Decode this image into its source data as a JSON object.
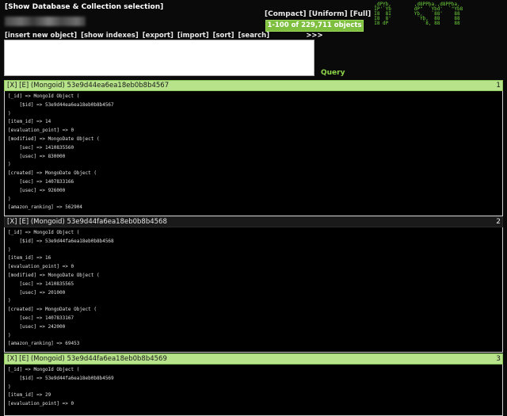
{
  "header": {
    "show_db_link": "[Show Database & Collection selection]",
    "view_compact": "[Compact]",
    "view_uniform": "[Uniform]",
    "view_full": "[Full]",
    "count_button": "1-100 of 229,711 objects >>>"
  },
  "ascii_logo": "  ,dPYb,        ,d8PPba.,d8PPba,\n  IP'`Yb        dP\"  `Ybd'  `\"Yb8\n  I8  8I        Yb,   `88'    88\n  I8  8'         `Yb,  88     88\n  I8 dP            `8, 88     88\n",
  "toolbar": {
    "insert": "[insert new object]",
    "indexes": "[show indexes]",
    "export": "[export]",
    "import": "[import]",
    "sort": "[sort]",
    "search": "[search]"
  },
  "query": {
    "value": "",
    "button": "Query"
  },
  "records": [
    {
      "title": "[X] [E] (Mongoid) 53e9d44ea6ea18eb0b8b4567",
      "num": "1",
      "lines": [
        "[_id] => MongoId Object (",
        "    [$id] => 53e9d44ea6ea18eb0b8b4567",
        ")",
        "[item_id] => 14",
        "[evaluation_point] => 0",
        "[modified] => MongoDate Object (",
        "    [sec] => 1410835560",
        "    [usec] => 830000",
        ")",
        "[created] => MongoDate Object (",
        "    [sec] => 1407833166",
        "    [usec] => 926000",
        ")",
        "[amazon_ranking] => 562904"
      ]
    },
    {
      "title": "[X] [E] (Mongoid) 53e9d44fa6ea18eb0b8b4568",
      "num": "2",
      "lines": [
        "[_id] => MongoId Object (",
        "    [$id] => 53e9d44fa6ea18eb0b8b4568",
        ")",
        "[item_id] => 16",
        "[evaluation_point] => 0",
        "[modified] => MongoDate Object (",
        "    [sec] => 1410835565",
        "    [usec] => 201000",
        ")",
        "[created] => MongoDate Object (",
        "    [sec] => 1407833167",
        "    [usec] => 242000",
        ")",
        "[amazon_ranking] => 69453"
      ]
    },
    {
      "title": "[X] [E] (Mongoid) 53e9d44fa6ea18eb0b8b4569",
      "num": "3",
      "lines": [
        "[_id] => MongoId Object (",
        "    [$id] => 53e9d44fa6ea18eb0b8b4569",
        ")",
        "[item_id] => 29",
        "[evaluation_point] => 0"
      ]
    }
  ]
}
